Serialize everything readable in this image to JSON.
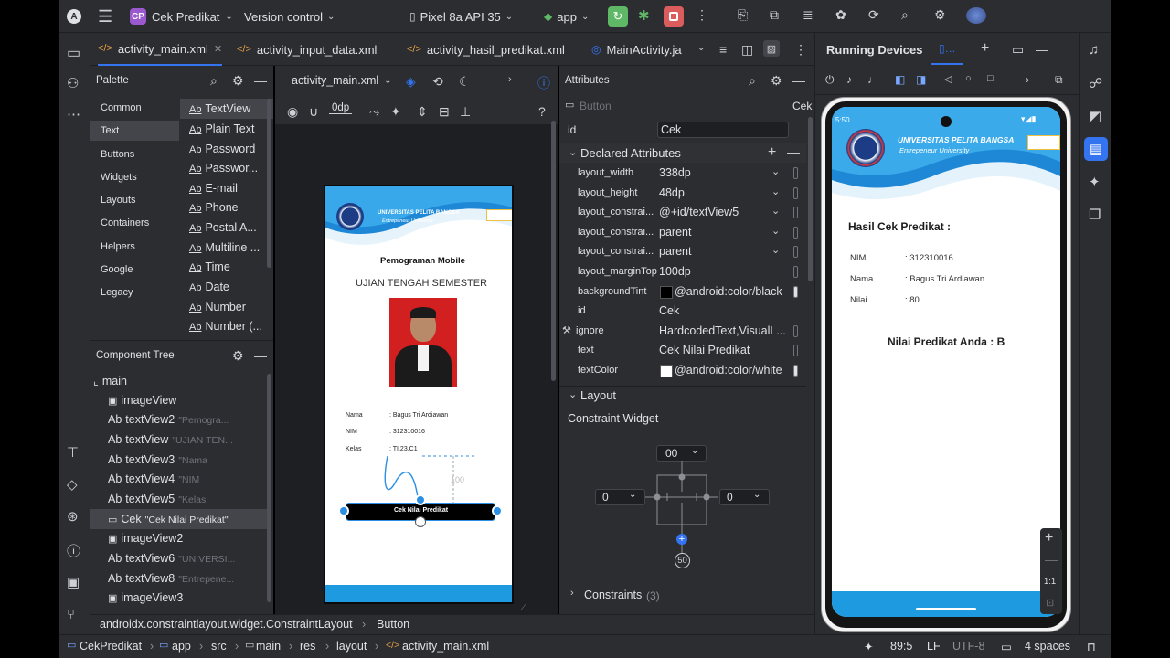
{
  "toolbar": {
    "project_badge": "CP",
    "project": "Cek Predikat",
    "vcs": "Version control",
    "device": "Pixel 8a API 35",
    "run_config": "app"
  },
  "tabs": [
    {
      "label": "activity_main.xml"
    },
    {
      "label": "activity_input_data.xml"
    },
    {
      "label": "activity_hasil_predikat.xml"
    },
    {
      "label": "MainActivity.ja"
    }
  ],
  "palette": {
    "title": "Palette",
    "categories": [
      "Common",
      "Text",
      "Buttons",
      "Widgets",
      "Layouts",
      "Containers",
      "Helpers",
      "Google",
      "Legacy"
    ],
    "items": [
      "TextView",
      "Plain Text",
      "Password",
      "Passwor...",
      "E-mail",
      "Phone",
      "Postal A...",
      "Multiline ...",
      "Time",
      "Date",
      "Number",
      "Number (..."
    ],
    "ab": "Ab"
  },
  "component_tree": {
    "title": "Component Tree",
    "root": "main",
    "nodes": [
      {
        "name": "imageView",
        "sub": ""
      },
      {
        "name": "textView2",
        "sub": "\"Pemogra..."
      },
      {
        "name": "textView",
        "sub": "\"UJIAN TEN..."
      },
      {
        "name": "textView3",
        "sub": "\"Nama"
      },
      {
        "name": "textView4",
        "sub": "\"NIM"
      },
      {
        "name": "textView5",
        "sub": "\"Kelas"
      },
      {
        "name": "Cek",
        "sub": "\"Cek Nilai Predikat\""
      },
      {
        "name": "imageView2",
        "sub": ""
      },
      {
        "name": "textView6",
        "sub": "\"UNIVERSI..."
      },
      {
        "name": "textView8",
        "sub": "\"Entrepene..."
      },
      {
        "name": "imageView3",
        "sub": ""
      }
    ]
  },
  "design": {
    "file": "activity_main.xml",
    "margin": "0dp",
    "help": "?",
    "univ": "UNIVERSITAS PELITA BANGSA",
    "tagline": "Entrepeneur University",
    "course": "Pemograman Mobile",
    "exam": "UJIAN TENGAH SEMESTER",
    "rows": [
      {
        "label": "Nama",
        "value": ": Bagus Tri Ardiawan"
      },
      {
        "label": "NIM",
        "value": ": 312310016"
      },
      {
        "label": "Kelas",
        "value": ": TI.23.C1"
      }
    ],
    "margin_label": "100",
    "button": "Cek Nilai Predikat"
  },
  "attributes": {
    "title": "Attributes",
    "widget": "Button",
    "widget_id": "Cek",
    "id_label": "id",
    "id_value": "Cek",
    "declared": "Declared Attributes",
    "rows": [
      {
        "k": "layout_width",
        "v": "338dp"
      },
      {
        "k": "layout_height",
        "v": "48dp"
      },
      {
        "k": "layout_constrai...",
        "v": "@+id/textView5"
      },
      {
        "k": "layout_constrai...",
        "v": "parent"
      },
      {
        "k": "layout_constrai...",
        "v": "parent"
      },
      {
        "k": "layout_marginTop",
        "v": "100dp"
      },
      {
        "k": "backgroundTint",
        "v": "@android:color/black"
      },
      {
        "k": "id",
        "v": "Cek"
      },
      {
        "k": "ignore",
        "v": "HardcodedText,VisualL..."
      },
      {
        "k": "text",
        "v": "Cek Nilai Predikat"
      },
      {
        "k": "textColor",
        "v": "@android:color/white"
      }
    ],
    "layout": "Layout",
    "constraint_widget": "Constraint Widget",
    "top_margin": "00",
    "left_margin": "0",
    "right_margin": "0",
    "bias": "50",
    "constraints": "Constraints",
    "constraints_count": "(3)"
  },
  "running": {
    "title": "Running Devices",
    "time": "5:50",
    "univ": "UNIVERSITAS PELITA BANGSA",
    "tagline": "Entrepeneur University",
    "heading": "Hasil Cek Predikat :",
    "rows": [
      {
        "label": "NIM",
        "value": ": 312310016"
      },
      {
        "label": "Nama",
        "value": ": Bagus Tri Ardiawan"
      },
      {
        "label": "Nilai",
        "value": ": 80"
      }
    ],
    "result": "Nilai Predikat Anda : B",
    "zoom": "1:1"
  },
  "breadcrumb": [
    "androidx.constraintlayout.widget.ConstraintLayout",
    "Button"
  ],
  "status": {
    "path": [
      "CekPredikat",
      "app",
      "src",
      "main",
      "res",
      "layout",
      "activity_main.xml"
    ],
    "position": "89:5",
    "line_sep": "LF",
    "encoding": "UTF-8",
    "indent": "4 spaces"
  },
  "colors": {
    "accent": "#3574f0",
    "run_green": "#5fb865",
    "stop_red": "#db5c5c",
    "wave_blue": "#2196d8"
  }
}
